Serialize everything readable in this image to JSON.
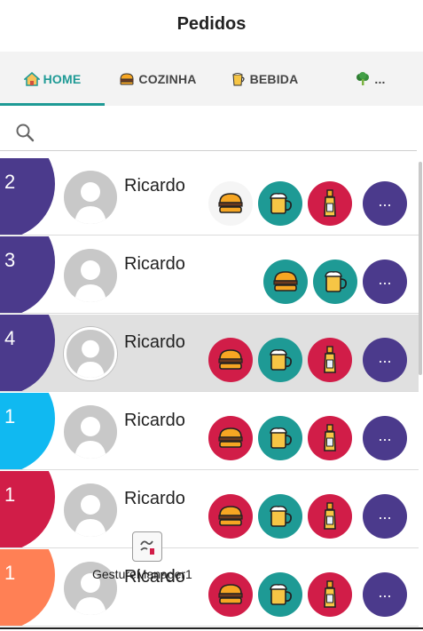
{
  "header": {
    "title": "Pedidos"
  },
  "tabs": [
    {
      "label": "HOME",
      "icon": "home-icon",
      "active": true
    },
    {
      "label": "COZINHA",
      "icon": "burger-icon",
      "active": false
    },
    {
      "label": "BEBIDA",
      "icon": "drink-icon",
      "active": false
    },
    {
      "label": "...",
      "icon": "broccoli-icon",
      "active": false
    }
  ],
  "search": {
    "icon": "search-icon"
  },
  "colors": {
    "accent": "#1e9a95",
    "purple": "#4b3a8c",
    "cyan": "#10b9f1",
    "crimson": "#d11d48",
    "orange": "#ff8055",
    "teal_bg": "#1e9a95",
    "red_bg": "#d11d48",
    "light_bg": "#f5f5f5"
  },
  "orders": [
    {
      "count": "2",
      "name": "Ricardo",
      "color": "#4b3a8c",
      "more": "...",
      "items": [
        "burger-light",
        "beer-teal",
        "bottle-red"
      ]
    },
    {
      "count": "3",
      "name": "Ricardo",
      "color": "#4b3a8c",
      "more": "...",
      "items": [
        "burger-teal",
        "beer-teal"
      ]
    },
    {
      "count": "4",
      "name": "Ricardo",
      "color": "#4b3a8c",
      "more": "...",
      "items": [
        "burger-red",
        "beer-teal",
        "bottle-red"
      ]
    },
    {
      "count": "1",
      "name": "Ricardo",
      "color": "#10b9f1",
      "more": "...",
      "items": [
        "burger-red",
        "beer-teal",
        "bottle-red"
      ]
    },
    {
      "count": "1",
      "name": "Ricardo",
      "color": "#d11d48",
      "more": "...",
      "items": [
        "burger-red",
        "beer-teal",
        "bottle-red"
      ]
    },
    {
      "count": "1",
      "name": "Ricardo",
      "color": "#ff8055",
      "more": "...",
      "items": [
        "burger-red",
        "beer-teal",
        "bottle-red"
      ]
    }
  ],
  "overlay": {
    "label": "GestureManager1",
    "icon": "gesture-manager-icon"
  }
}
